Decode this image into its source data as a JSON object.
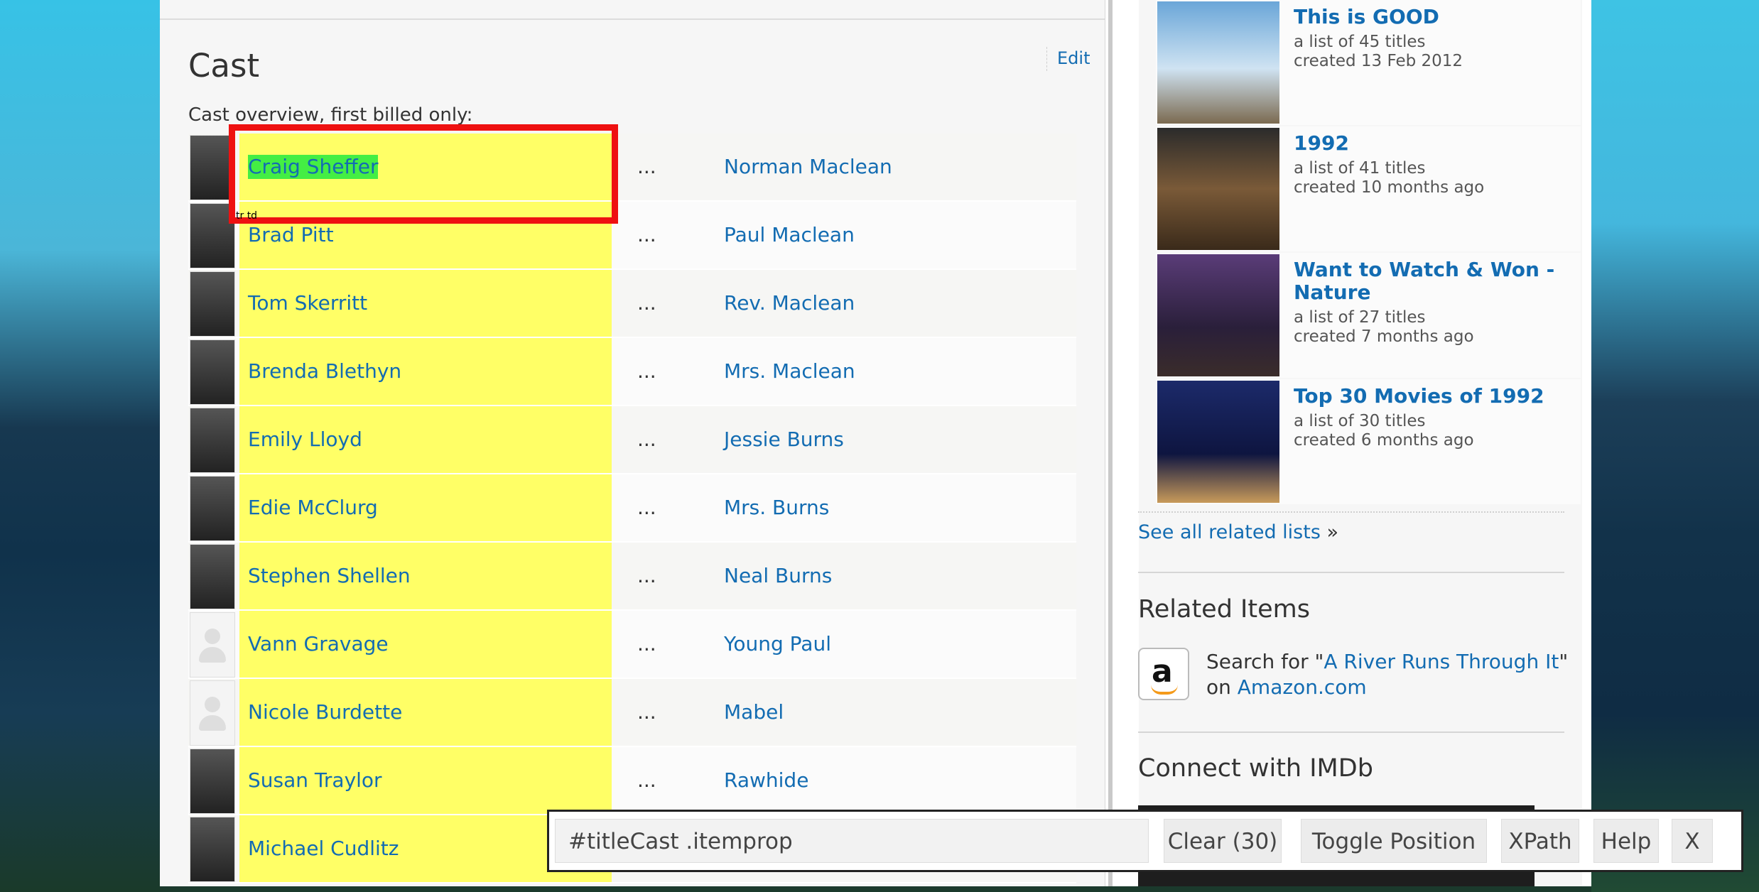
{
  "cast": {
    "title": "Cast",
    "edit_label": "Edit",
    "subtitle": "Cast overview, first billed only:",
    "rows": [
      {
        "actor": "Craig Sheffer",
        "character": "Norman Maclean",
        "dots": "..."
      },
      {
        "actor": "Brad Pitt",
        "character": "Paul Maclean",
        "dots": "..."
      },
      {
        "actor": "Tom Skerritt",
        "character": "Rev. Maclean",
        "dots": "..."
      },
      {
        "actor": "Brenda Blethyn",
        "character": "Mrs. Maclean",
        "dots": "..."
      },
      {
        "actor": "Emily Lloyd",
        "character": "Jessie Burns",
        "dots": "..."
      },
      {
        "actor": "Edie McClurg",
        "character": "Mrs. Burns",
        "dots": "..."
      },
      {
        "actor": "Stephen Shellen",
        "character": "Neal Burns",
        "dots": "..."
      },
      {
        "actor": "Vann Gravage",
        "character": "Young Paul",
        "dots": "..."
      },
      {
        "actor": "Nicole Burdette",
        "character": "Mabel",
        "dots": "..."
      },
      {
        "actor": "Susan Traylor",
        "character": "Rawhide",
        "dots": "..."
      },
      {
        "actor": "Michael Cudlitz",
        "character": "",
        "dots": ""
      }
    ],
    "selection_tag": "tr td"
  },
  "sidebar": {
    "lists": [
      {
        "title": "This is GOOD",
        "count": "a list of 45 titles",
        "created": "created 13 Feb 2012"
      },
      {
        "title": "1992",
        "count": "a list of 41 titles",
        "created": "created 10 months ago"
      },
      {
        "title": "Want to Watch & Won - Nature",
        "count": "a list of 27 titles",
        "created": "created 7 months ago"
      },
      {
        "title": "Top 30 Movies of 1992",
        "count": "a list of 30 titles",
        "created": "created 6 months ago"
      }
    ],
    "see_all": "See all related lists",
    "see_all_raquo": "»",
    "related_heading": "Related Items",
    "related_prefix": "Search for \"",
    "related_link": "A River Runs Through It",
    "related_suffix": "\"",
    "related_on": "on ",
    "related_amazon": "Amazon.com",
    "connect_heading": "Connect with IMDb"
  },
  "selector_gadget": {
    "selector": "#titleCast .itemprop",
    "clear_label": "Clear (30)",
    "toggle_label": "Toggle Position",
    "xpath_label": "XPath",
    "help_label": "Help",
    "close_label": "X"
  }
}
